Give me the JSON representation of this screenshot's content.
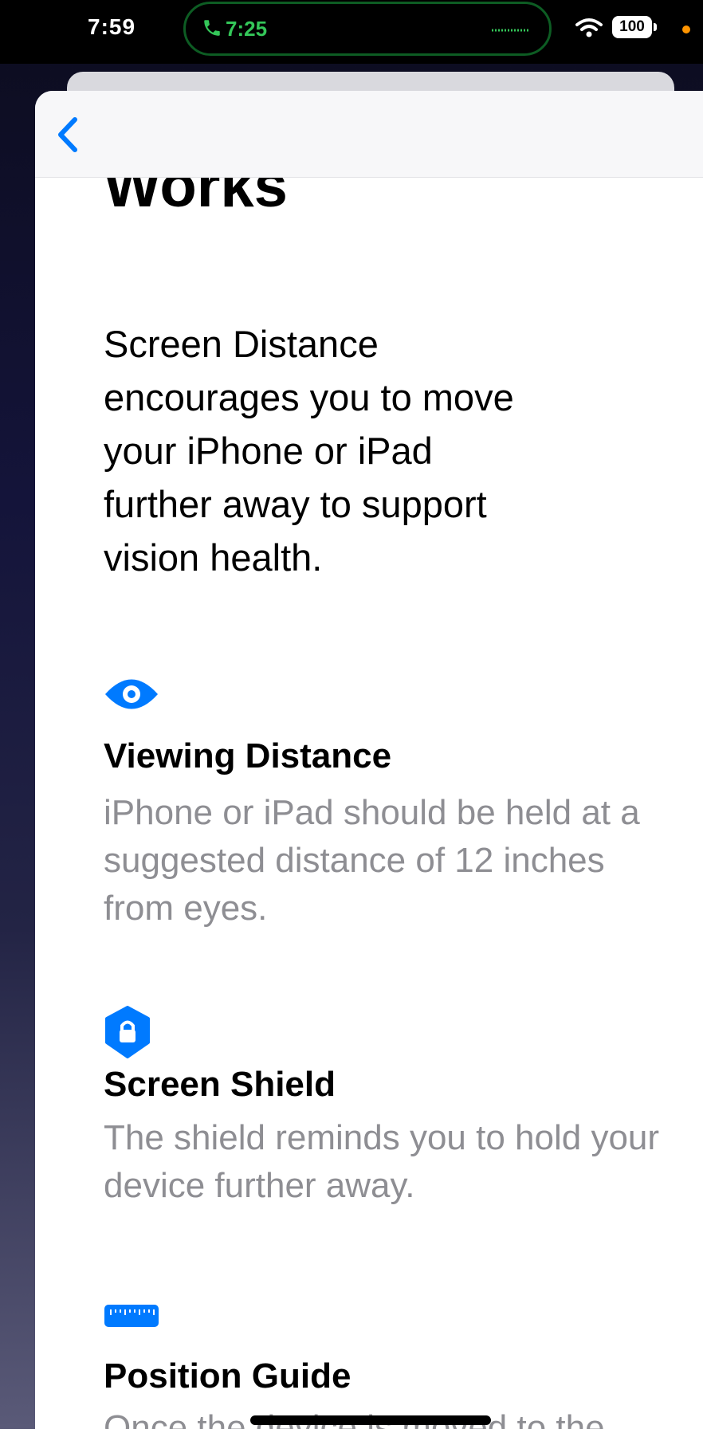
{
  "status_bar": {
    "time": "7:59",
    "call_duration": "7:25",
    "battery": "100"
  },
  "page": {
    "title_fragment": "Works",
    "intro": "Screen Distance encourages you to move your iPhone or iPad further away to support vision health."
  },
  "features": [
    {
      "icon": "eye-icon",
      "title": "Viewing Distance",
      "description": "iPhone or iPad should be held at a suggested distance of 12 inches from eyes."
    },
    {
      "icon": "shield-lock-icon",
      "title": "Screen Shield",
      "description": "The shield reminds you to hold your device further away."
    },
    {
      "icon": "ruler-icon",
      "title": "Position Guide",
      "description": "Once the device is moved to the suggested distance, the"
    }
  ],
  "colors": {
    "accent": "#007aff",
    "secondary_text": "#8e8e93",
    "call_green": "#34c759"
  }
}
